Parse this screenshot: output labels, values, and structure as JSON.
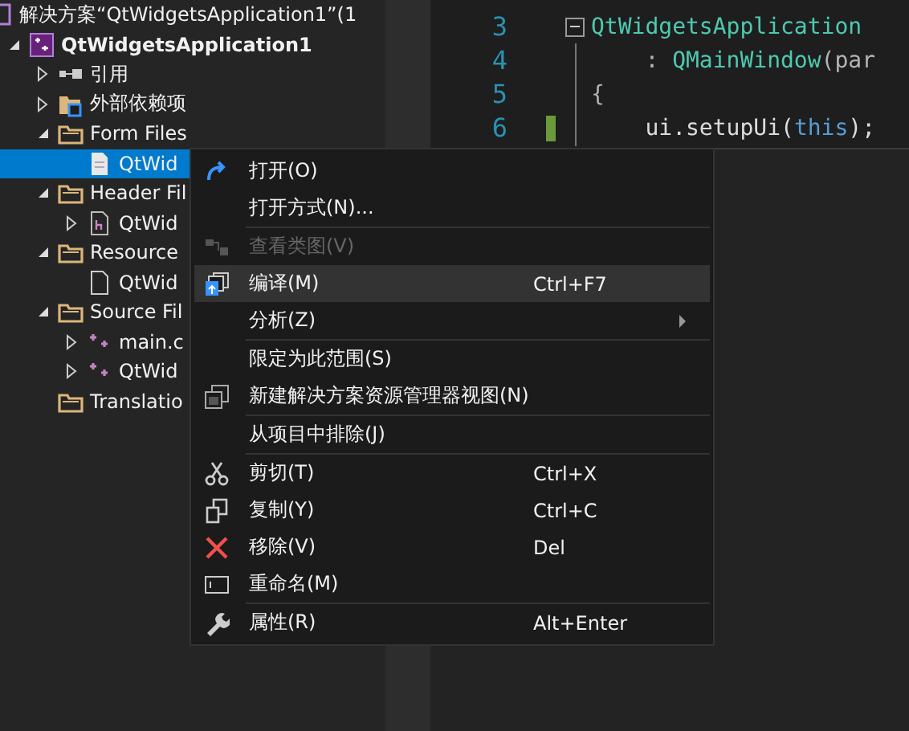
{
  "solution_explorer": {
    "title": "解决方案“QtWidgetsApplication1”(1",
    "tree": [
      {
        "label": "QtWidgetsApplication1",
        "kind": "project",
        "expanded": true,
        "selected": false,
        "children": [
          {
            "label": "引用",
            "kind": "references",
            "expanded": false,
            "selected": false
          },
          {
            "label": "外部依赖项",
            "kind": "external",
            "expanded": false,
            "selected": false
          },
          {
            "label": "Form Files",
            "kind": "folder",
            "expanded": true,
            "selected": false,
            "children": [
              {
                "label": "QtWid",
                "kind": "ui-file",
                "selected": true
              }
            ]
          },
          {
            "label": "Header Fil",
            "kind": "folder",
            "expanded": true,
            "selected": false,
            "children": [
              {
                "label": "QtWid",
                "kind": "header-file",
                "expanded": false,
                "selected": false
              }
            ]
          },
          {
            "label": "Resource",
            "kind": "folder",
            "expanded": true,
            "selected": false,
            "children": [
              {
                "label": "QtWid",
                "kind": "resource-file",
                "selected": false
              }
            ]
          },
          {
            "label": "Source Fil",
            "kind": "folder",
            "expanded": true,
            "selected": false,
            "children": [
              {
                "label": "main.c",
                "kind": "cpp-file",
                "expanded": false,
                "selected": false
              },
              {
                "label": "QtWid",
                "kind": "cpp-file",
                "expanded": false,
                "selected": false
              }
            ]
          },
          {
            "label": "Translatio",
            "kind": "folder",
            "selected": false
          }
        ]
      }
    ]
  },
  "editor": {
    "lines": [
      {
        "number": "3",
        "fold": true,
        "changed": false,
        "tokens": [
          {
            "text": "QtWidgetsApplication",
            "kind": "type"
          }
        ]
      },
      {
        "number": "4",
        "fold": false,
        "changed": false,
        "tokens": [
          {
            "text": "    : ",
            "kind": "punct"
          },
          {
            "text": "QMainWindow",
            "kind": "type"
          },
          {
            "text": "(par",
            "kind": "punct"
          }
        ]
      },
      {
        "number": "5",
        "fold": false,
        "changed": false,
        "tokens": [
          {
            "text": "{",
            "kind": "punct"
          }
        ]
      },
      {
        "number": "6",
        "fold": false,
        "changed": true,
        "tokens": [
          {
            "text": "    ui.setupUi(",
            "kind": "plain"
          },
          {
            "text": "this",
            "kind": "keyword"
          },
          {
            "text": ");",
            "kind": "plain"
          }
        ]
      }
    ]
  },
  "context_menu": {
    "items": [
      {
        "kind": "open",
        "label": "打开(O)",
        "disabled": false,
        "selected": false
      },
      {
        "kind": "plain",
        "label": "打开方式(N)...",
        "disabled": false,
        "selected": false
      },
      {
        "kind": "separator"
      },
      {
        "kind": "class-diagram",
        "label": "查看类图(V)",
        "disabled": true,
        "selected": false
      },
      {
        "kind": "compile",
        "label": "编译(M)",
        "shortcut": "Ctrl+F7",
        "disabled": false,
        "selected": true
      },
      {
        "kind": "submenu",
        "label": "分析(Z)",
        "disabled": false,
        "selected": false
      },
      {
        "kind": "separator"
      },
      {
        "kind": "plain",
        "label": "限定为此范围(S)",
        "disabled": false,
        "selected": false
      },
      {
        "kind": "new-view",
        "label": "新建解决方案资源管理器视图(N)",
        "disabled": false,
        "selected": false
      },
      {
        "kind": "separator"
      },
      {
        "kind": "plain",
        "label": "从项目中排除(J)",
        "disabled": false,
        "selected": false
      },
      {
        "kind": "separator"
      },
      {
        "kind": "cut",
        "label": "剪切(T)",
        "shortcut": "Ctrl+X",
        "disabled": false,
        "selected": false
      },
      {
        "kind": "copy",
        "label": "复制(Y)",
        "shortcut": "Ctrl+C",
        "disabled": false,
        "selected": false
      },
      {
        "kind": "remove",
        "label": "移除(V)",
        "shortcut": "Del",
        "disabled": false,
        "selected": false
      },
      {
        "kind": "rename",
        "label": "重命名(M)",
        "disabled": false,
        "selected": false
      },
      {
        "kind": "separator"
      },
      {
        "kind": "properties",
        "label": "属性(R)",
        "shortcut": "Alt+Enter",
        "disabled": false,
        "selected": false
      }
    ]
  }
}
